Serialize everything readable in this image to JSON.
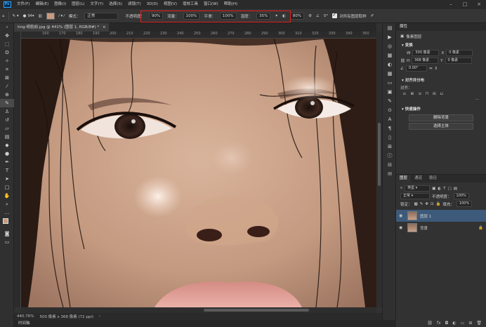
{
  "menubar": {
    "app_logo": "Ps",
    "items": [
      "文件(F)",
      "编辑(E)",
      "图像(I)",
      "图层(L)",
      "文字(Y)",
      "选择(S)",
      "滤镜(T)",
      "3D(D)",
      "视图(V)",
      "增效工具",
      "窗口(W)",
      "帮助(H)"
    ],
    "window_controls": [
      "–",
      "□",
      "×"
    ]
  },
  "options": {
    "brush_size": "94",
    "mode_label": "模式：",
    "mode_value": "正常",
    "opacity_label": "不透明度：",
    "opacity_value": "90%",
    "flow_label": "流量：",
    "flow_value": "100%",
    "smoothing_label": "平滑：",
    "smoothing_value": "100%",
    "jitter_label": "湿度：",
    "jitter_value": "35%",
    "angle_value": "0°",
    "sample_all_label": "对所有图层取样",
    "pressure_value": "80%"
  },
  "document": {
    "tab_title": "ting-修脸前.jpg @ 441% (图层 1, RGB/8#) *",
    "ruler_ticks": [
      "160",
      "170",
      "180",
      "190",
      "200",
      "210",
      "220",
      "230",
      "240",
      "250",
      "260",
      "270",
      "280",
      "290",
      "300",
      "310",
      "320",
      "330",
      "340",
      "350"
    ],
    "zoom": "440.76%",
    "doc_size": "500 像素 x 368 像素 (72 ppi)"
  },
  "timeline": {
    "label": "时间轴"
  },
  "properties": {
    "tab": "属性",
    "header": "像素图层",
    "transform_title": "变换",
    "w_label": "W",
    "w_value": "500 像素",
    "x_label": "X",
    "x_value": "0 像素",
    "h_label": "H",
    "h_value": "368 像素",
    "y_label": "Y",
    "y_value": "0 像素",
    "angle_value": "0.00°",
    "align_title": "对齐并分布",
    "align_label": "对齐：",
    "quick_actions_title": "快速操作",
    "btn_remove_bg": "删除背景",
    "btn_select_subject": "选择主体"
  },
  "layers": {
    "tabs": [
      "图层",
      "通道",
      "路径"
    ],
    "filter_kind": "类型",
    "blend_mode": "正常",
    "opacity_label": "不透明度：",
    "opacity_value": "100%",
    "lock_label": "锁定：",
    "fill_label": "填充：",
    "fill_value": "100%",
    "items": [
      {
        "name": "图层 1"
      },
      {
        "name": "背景"
      }
    ]
  },
  "colors": {
    "foreground": "#c89a80",
    "highlight_box": "#e0201a",
    "selected_layer": "#3d5a7a"
  }
}
